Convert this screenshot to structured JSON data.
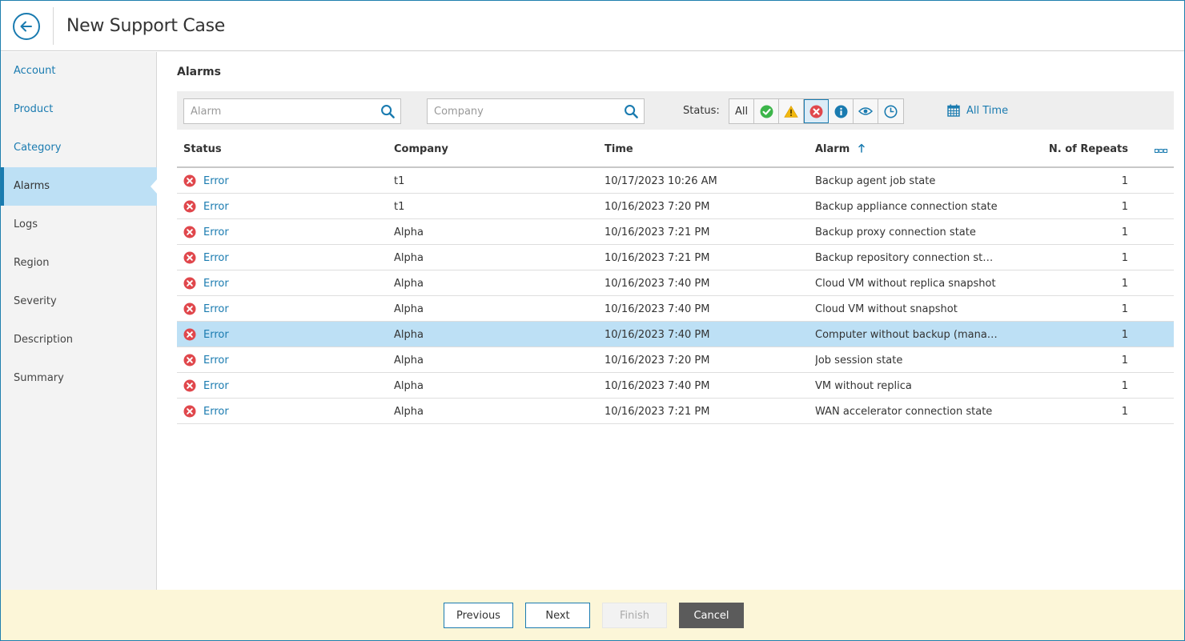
{
  "header": {
    "title": "New Support Case"
  },
  "sidebar": {
    "items": [
      {
        "label": "Account"
      },
      {
        "label": "Product"
      },
      {
        "label": "Category"
      },
      {
        "label": "Alarms"
      },
      {
        "label": "Logs"
      },
      {
        "label": "Region"
      },
      {
        "label": "Severity"
      },
      {
        "label": "Description"
      },
      {
        "label": "Summary"
      }
    ]
  },
  "main": {
    "title": "Alarms",
    "alarm_search": {
      "placeholder": "Alarm"
    },
    "company_search": {
      "placeholder": "Company"
    },
    "status_filter": {
      "label": "Status:",
      "all_label": "All",
      "selected": "error"
    },
    "time_filter": {
      "label": "All Time"
    },
    "table": {
      "columns": {
        "status": "Status",
        "company": "Company",
        "time": "Time",
        "alarm": "Alarm",
        "repeats": "N. of Repeats"
      },
      "rows": [
        {
          "status": "Error",
          "company": "t1",
          "time": "10/17/2023 10:26 AM",
          "alarm": "Backup agent job state",
          "repeats": "1"
        },
        {
          "status": "Error",
          "company": "t1",
          "time": "10/16/2023 7:20 PM",
          "alarm": "Backup appliance connection state",
          "repeats": "1"
        },
        {
          "status": "Error",
          "company": "Alpha",
          "time": "10/16/2023 7:21 PM",
          "alarm": "Backup proxy connection state",
          "repeats": "1"
        },
        {
          "status": "Error",
          "company": "Alpha",
          "time": "10/16/2023 7:21 PM",
          "alarm": "Backup repository connection state",
          "repeats": "1"
        },
        {
          "status": "Error",
          "company": "Alpha",
          "time": "10/16/2023 7:40 PM",
          "alarm": "Cloud VM without replica snapshot",
          "repeats": "1"
        },
        {
          "status": "Error",
          "company": "Alpha",
          "time": "10/16/2023 7:40 PM",
          "alarm": "Cloud VM without snapshot",
          "repeats": "1"
        },
        {
          "status": "Error",
          "company": "Alpha",
          "time": "10/16/2023 7:40 PM",
          "alarm": "Computer without backup (manage...",
          "repeats": "1"
        },
        {
          "status": "Error",
          "company": "Alpha",
          "time": "10/16/2023 7:20 PM",
          "alarm": "Job session state",
          "repeats": "1"
        },
        {
          "status": "Error",
          "company": "Alpha",
          "time": "10/16/2023 7:40 PM",
          "alarm": "VM without replica",
          "repeats": "1"
        },
        {
          "status": "Error",
          "company": "Alpha",
          "time": "10/16/2023 7:21 PM",
          "alarm": "WAN accelerator connection state",
          "repeats": "1"
        }
      ]
    }
  },
  "footer": {
    "previous_label": "Previous",
    "next_label": "Next",
    "finish_label": "Finish",
    "cancel_label": "Cancel"
  },
  "colors": {
    "accent": "#1a7bb0",
    "selected_row": "#bde0f5",
    "error": "#e0474c",
    "success": "#3cb54a",
    "warning": "#f2b90f",
    "info": "#1a7bb0",
    "footer_bg": "#fcf6d8"
  },
  "icons": {
    "back": "arrow-left-circle-icon",
    "search": "magnifier-icon",
    "calendar": "calendar-icon",
    "error": "error-x-circle-icon",
    "column_chooser": "column-chooser-icon"
  }
}
